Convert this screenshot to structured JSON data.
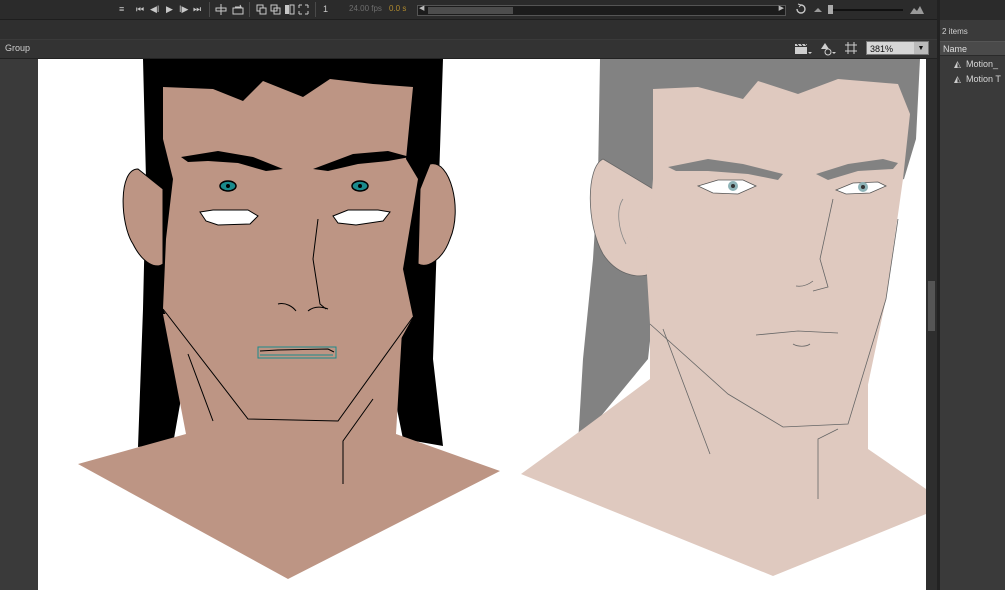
{
  "timeline": {
    "controls": [
      "≡",
      "⏮",
      "◀I",
      "▶",
      "I▶",
      "⏭"
    ],
    "fps_label": "24.00 fps",
    "frame_label": "0.0 s",
    "frame_number": "1"
  },
  "edit_bar": {
    "breadcrumb": "Group",
    "zoom_value": "381%",
    "zoom_dropdown_glyph": "▼"
  },
  "library": {
    "item_count": "2 items",
    "column_header": "Name",
    "items": [
      {
        "label": "Motion_"
      },
      {
        "label": "Motion T"
      }
    ]
  },
  "colors": {
    "left_skin": "#bd9584",
    "left_hair": "#000000",
    "right_skin": "#dfc9bf",
    "right_hair": "#828282",
    "eye_teal": "#1a8a8c"
  }
}
